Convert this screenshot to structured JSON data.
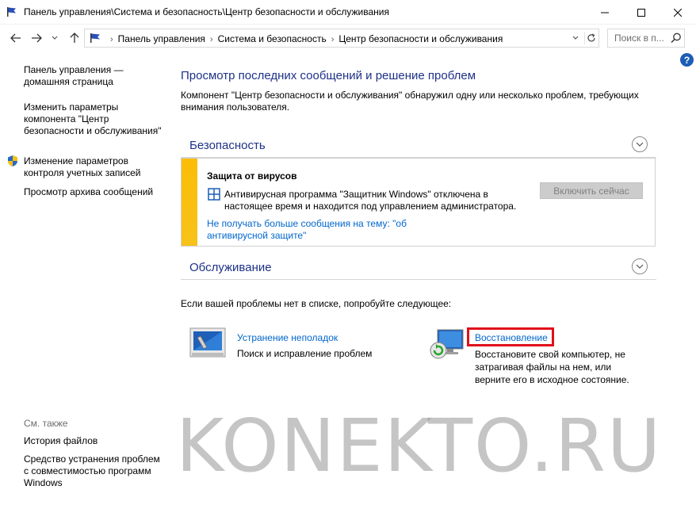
{
  "window": {
    "title": "Панель управления\\Система и безопасность\\Центр безопасности и обслуживания"
  },
  "address": {
    "crumbs": [
      "Панель управления",
      "Система и безопасность",
      "Центр безопасности и обслуживания"
    ],
    "search_placeholder": "Поиск в п..."
  },
  "help_label": "?",
  "sidebar": {
    "links": [
      "Панель управления — домашняя страница",
      "Изменить параметры компонента \"Центр безопасности и обслуживания\"",
      "Изменение параметров контроля учетных записей",
      "Просмотр архива сообщений"
    ],
    "see_also_title": "См. также",
    "see_also_links": [
      "История файлов",
      "Средство устранения проблем с совместимостью программ Windows"
    ]
  },
  "main": {
    "title": "Просмотр последних сообщений и решение проблем",
    "description": "Компонент \"Центр безопасности и обслуживания\" обнаружил одну или несколько проблем, требующих внимания пользователя.",
    "security": {
      "title": "Безопасность",
      "alert_title": "Защита от вирусов",
      "alert_text": "Антивирусная программа \"Защитник Windows\" отключена в настоящее время и находится под управлением администратора.",
      "alert_link": "Не получать больше сообщения на тему: \"об антивирусной защите\"",
      "enable_button": "Включить сейчас"
    },
    "maintenance": {
      "title": "Обслуживание"
    },
    "try_text": "Если вашей проблемы нет в списке, попробуйте следующее:",
    "tools": [
      {
        "link": "Устранение неполадок",
        "desc": "Поиск и исправление проблем"
      },
      {
        "link": "Восстановление",
        "desc": "Восстановите свой компьютер, не затрагивая файлы на нем, или верните его в исходное состояние."
      }
    ]
  },
  "watermark": "KONEKTO.RU",
  "colors": {
    "heading": "#1e3287",
    "link": "#0066cc",
    "warning_stripe": "#fbbd07",
    "highlight": "#e0101a"
  }
}
